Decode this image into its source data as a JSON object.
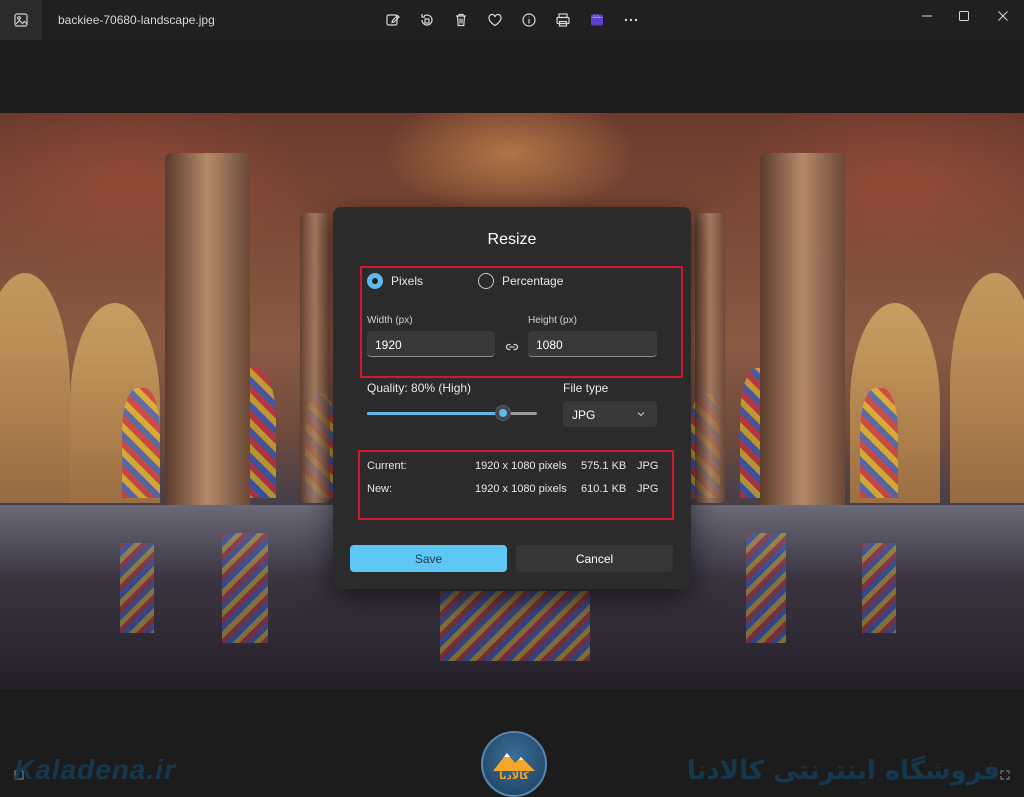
{
  "titlebar": {
    "filename": "backiee-70680-landscape.jpg",
    "tools": [
      "edit-image-icon",
      "rotate-icon",
      "delete-icon",
      "favorite-icon",
      "info-icon",
      "print-icon",
      "clipchamp-icon",
      "more-icon"
    ],
    "window_controls": [
      "minimize-icon",
      "maximize-icon",
      "close-icon"
    ]
  },
  "dialog": {
    "title": "Resize",
    "mode": {
      "pixels_label": "Pixels",
      "percentage_label": "Percentage",
      "selected": "Pixels"
    },
    "width_label": "Width  (px)",
    "width_value": "1920",
    "height_label": "Height  (px)",
    "height_value": "1080",
    "quality_label": "Quality: 80% (High)",
    "quality_value": 80,
    "file_type_label": "File type",
    "file_type_value": "JPG",
    "current": {
      "label": "Current:",
      "dimensions": "1920 x 1080 pixels",
      "size": "575.1 KB",
      "format": "JPG"
    },
    "new": {
      "label": "New:",
      "dimensions": "1920 x 1080 pixels",
      "size": "610.1 KB",
      "format": "JPG"
    },
    "save_label": "Save",
    "cancel_label": "Cancel"
  },
  "watermark": {
    "left_text": "Kaladena.ir",
    "right_text": "فروشگاه اینترنتی کالادنا",
    "logo_text": "کالادنا"
  },
  "colors": {
    "accent": "#5fc7f5",
    "annotation": "#d0192c",
    "dialog_bg": "#2b2b2b"
  }
}
